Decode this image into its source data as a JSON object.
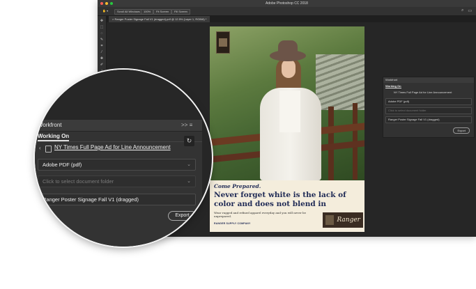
{
  "app": {
    "title": "Adobe Photoshop CC 2018",
    "options": [
      "Scroll All Windows",
      "100%",
      "Fit Screen",
      "Fill Screen"
    ],
    "doc_tab": "Ranger Poster Signage Fall V1 (dragged).pdf @ 12.5% (Layer 1, RGB/8) *"
  },
  "poster": {
    "tagline": "Come Prepared.",
    "headline": "Never forget white is the lack of color and does not blend in",
    "body": "Wear rugged and refined apparel everyday and you will never be unprepared.",
    "company": "RANGER SUPPLY COMPANY",
    "logo": "Ranger"
  },
  "workfront": {
    "panel_title": "Workfront",
    "header_icons": ">> ≡",
    "working_on_label": "Working On",
    "document_link": "NY Times Full Page Ad for Line Announcement",
    "format": "Adobe PDF (pdf)",
    "folder_placeholder": "Click to select document folder",
    "filename": "Ranger Poster Signage Fall V1 (dragged)",
    "export_label": "Export"
  }
}
